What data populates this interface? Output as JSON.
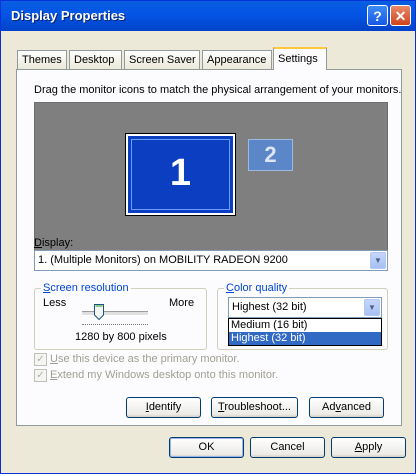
{
  "window": {
    "title": "Display Properties"
  },
  "titlebar": {
    "help_label": "?",
    "close_label": "✕"
  },
  "tabs": [
    {
      "label": "Themes"
    },
    {
      "label": "Desktop"
    },
    {
      "label": "Screen Saver"
    },
    {
      "label": "Appearance"
    },
    {
      "label": "Settings"
    }
  ],
  "settings": {
    "instruction": "Drag the monitor icons to match the physical arrangement of your monitors.",
    "monitors": [
      {
        "number": "1"
      },
      {
        "number": "2"
      }
    ],
    "display": {
      "label_accel": "D",
      "label_rest": "isplay:",
      "value": "1. (Multiple Monitors) on MOBILITY RADEON 9200"
    },
    "resolution": {
      "title_accel": "S",
      "title_rest": "creen resolution",
      "less": "Less",
      "more": "More",
      "value": "1280 by 800 pixels",
      "slider_position": 0.25
    },
    "color_quality": {
      "title_accel": "C",
      "title_rest": "olor quality",
      "selected": "Highest (32 bit)",
      "options": [
        "Medium (16 bit)",
        "Highest (32 bit)"
      ]
    },
    "checkboxes": [
      {
        "accel": "U",
        "rest": "se this device as the primary monitor.",
        "checked": true
      },
      {
        "accel": "E",
        "rest": "xtend my Windows desktop onto this monitor.",
        "checked": true
      }
    ],
    "buttons": {
      "identify": {
        "accel": "I",
        "rest": "dentify"
      },
      "troubleshoot": {
        "accel": "T",
        "rest": "roubleshoot..."
      },
      "advanced": {
        "pre": "Ad",
        "accel": "v",
        "rest": "anced"
      }
    }
  },
  "footer": {
    "ok": "OK",
    "cancel": "Cancel",
    "apply": {
      "accel": "A",
      "rest": "pply"
    }
  },
  "icons": {
    "dropdown": "chevron-down-icon",
    "check": "checkmark-icon"
  }
}
